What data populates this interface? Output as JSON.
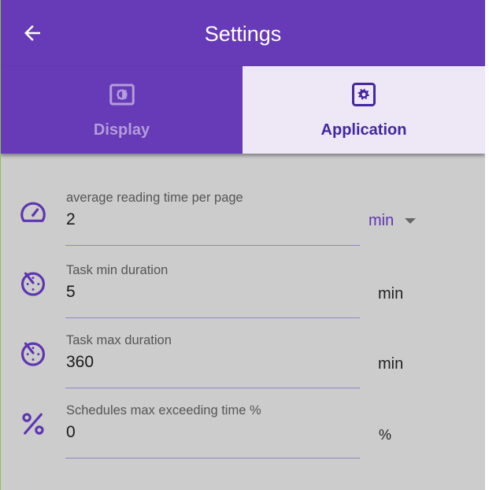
{
  "header": {
    "title": "Settings",
    "back_icon": "arrow-left-icon"
  },
  "tabs": [
    {
      "label": "Display",
      "icon": "brightness-icon",
      "selected": false
    },
    {
      "label": "Application",
      "icon": "gear-icon",
      "selected": true
    }
  ],
  "settings": [
    {
      "label": "average reading time per page",
      "value": "2",
      "unit": "min",
      "unit_is_dropdown": true,
      "icon": "speedometer-icon"
    },
    {
      "label": "Task min duration",
      "value": "5",
      "unit": "min",
      "icon": "timer-icon"
    },
    {
      "label": "Task max duration",
      "value": "360",
      "unit": "min",
      "icon": "timer-icon"
    },
    {
      "label": "Schedules max exceeding time %",
      "value": "0",
      "unit": "%",
      "icon": "percent-icon"
    }
  ],
  "colors": {
    "primary": "#673ab7",
    "selected_tab_bg": "#ede7f6",
    "selected_tab_text": "#4527a0",
    "background": "#cccccc"
  }
}
